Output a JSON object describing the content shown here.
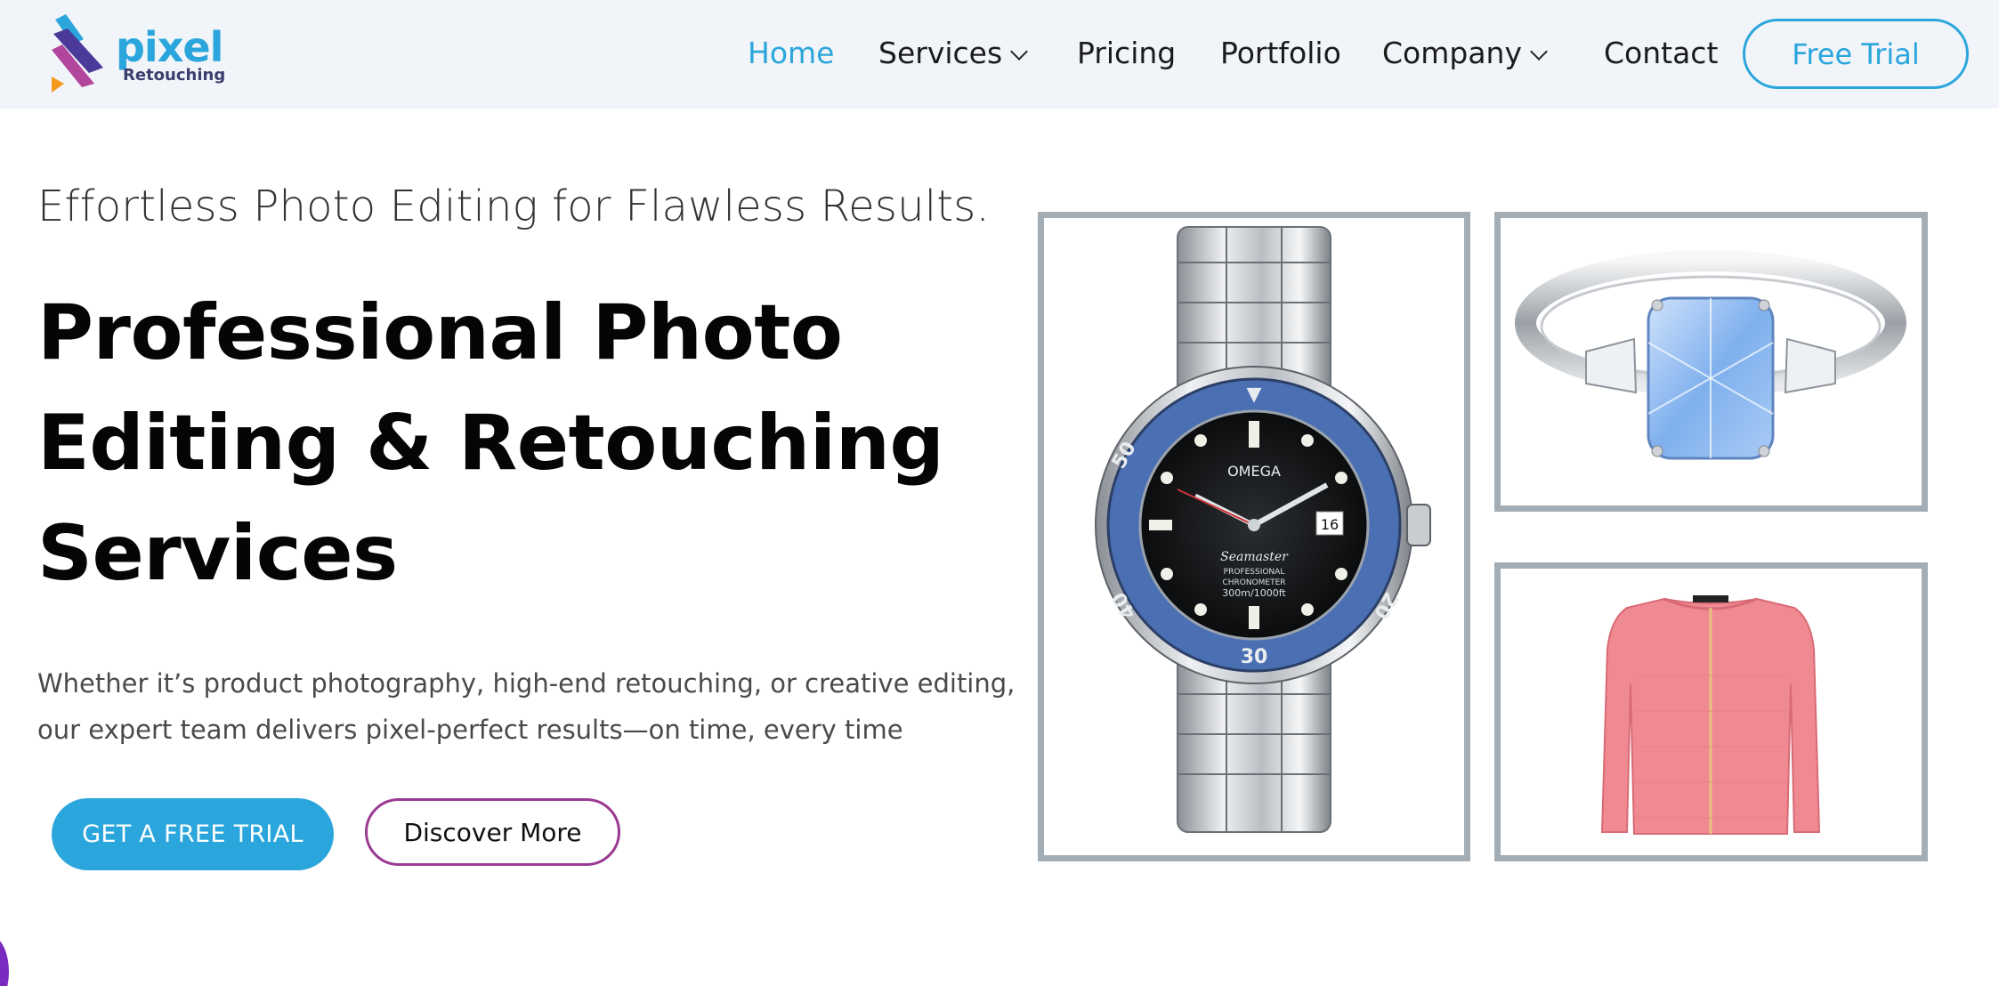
{
  "brand": {
    "name": "pixel",
    "subtitle": "Retouching",
    "colors": {
      "primary": "#2aa6dc",
      "accent": "#9a3a93",
      "header_bg": "#f1f4f8",
      "frame": "#a3adb6"
    }
  },
  "nav": {
    "items": [
      {
        "label": "Home",
        "active": true
      },
      {
        "label": "Services",
        "dropdown": true
      },
      {
        "label": "Pricing"
      },
      {
        "label": "Portfolio"
      },
      {
        "label": "Company",
        "dropdown": true
      },
      {
        "label": "Contact"
      }
    ],
    "cta_label": "Free Trial"
  },
  "hero": {
    "tagline": "Effortless Photo Editing for Flawless Results.",
    "headline_lines": [
      "Professional Photo",
      "Editing & Retouching",
      "Services"
    ],
    "description_lines": [
      "Whether it’s product photography, high-end retouching, or creative editing,",
      "our expert team delivers pixel-perfect results—on time, every time"
    ],
    "primary_cta": "GET A FREE TRIAL",
    "secondary_cta": "Discover More"
  },
  "gallery": {
    "items": [
      {
        "icon": "watch-product-image"
      },
      {
        "icon": "ring-product-image"
      },
      {
        "icon": "sweater-product-image"
      }
    ],
    "watch_text": {
      "brand": "OMEGA",
      "model": "Seamaster",
      "line1": "PROFESSIONAL",
      "line2": "CHRONOMETER",
      "line3": "300m/1000ft",
      "date": "16"
    }
  }
}
